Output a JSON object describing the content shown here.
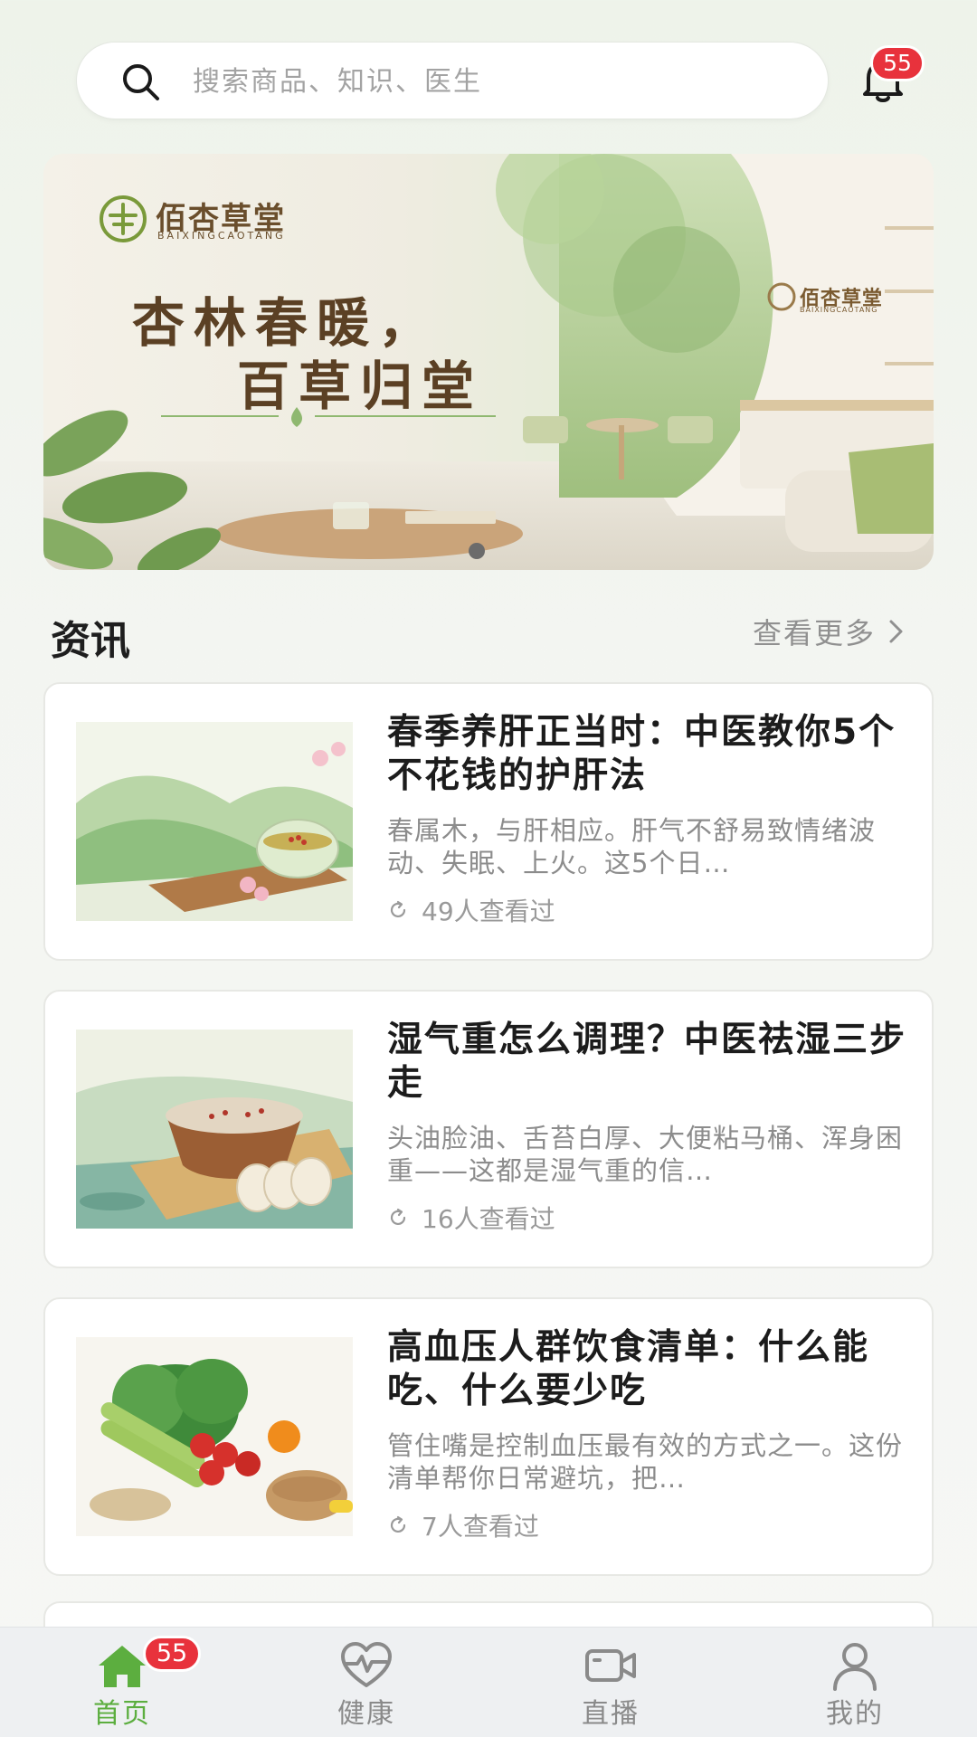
{
  "search": {
    "placeholder": "搜索商品、知识、医生"
  },
  "notifications": {
    "badge_count": "55"
  },
  "banner": {
    "brand_name": "佰杏草堂",
    "brand_sub": "BAIXINGCAOTANG",
    "slogan_line1": "杏林春暖，",
    "slogan_line2": "百草归堂",
    "wall_logo_name": "佰杏草堂",
    "wall_logo_sub": "BAIXINGCAOTANG"
  },
  "news_section": {
    "title": "资讯",
    "more_label": "查看更多"
  },
  "articles": [
    {
      "title": "春季养肝正当时：中医教你5个不花钱的护肝法",
      "summary": "春属木，与肝相应。肝气不舒易致情绪波动、失眠、上火。这5个日…",
      "views": "49人查看过"
    },
    {
      "title": "湿气重怎么调理？中医祛湿三步走",
      "summary": "头油脸油、舌苔白厚、大便粘马桶、浑身困重——这都是湿气重的信…",
      "views": "16人查看过"
    },
    {
      "title": "高血压人群饮食清单：什么能吃、什么要少吃",
      "summary": "管住嘴是控制血压最有效的方式之一。这份清单帮你日常避坑，把…",
      "views": "7人查看过"
    }
  ],
  "bottom_nav": {
    "badge_count": "55",
    "items": [
      {
        "label": "首页",
        "icon": "home-icon",
        "active": true
      },
      {
        "label": "健康",
        "icon": "heart-pulse-icon",
        "active": false
      },
      {
        "label": "直播",
        "icon": "video-camera-icon",
        "active": false
      },
      {
        "label": "我的",
        "icon": "user-icon",
        "active": false
      }
    ]
  },
  "colors": {
    "accent_green": "#5cae3f",
    "badge_red": "#e8323c",
    "banner_text_brown": "#5b4024"
  }
}
